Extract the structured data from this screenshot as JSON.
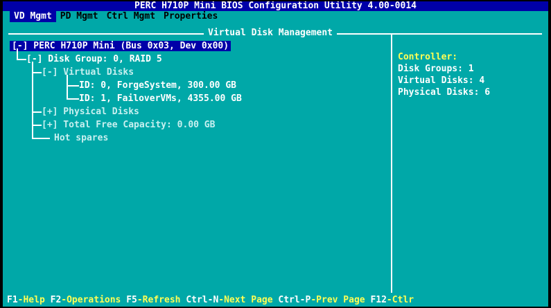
{
  "title": "PERC H710P Mini BIOS Configuration Utility 4.00-0014",
  "menu": [
    {
      "label": "VD Mgmt"
    },
    {
      "label": "PD Mgmt"
    },
    {
      "label": "Ctrl Mgmt"
    },
    {
      "label": "Properties"
    }
  ],
  "panel_title": "Virtual Disk Management",
  "tree": {
    "root": "[-] PERC H710P Mini (Bus 0x03, Dev 0x00)",
    "disk_group": "[-] Disk Group: 0, RAID 5",
    "virtual_disks": "[-] Virtual Disks",
    "vd0": "ID: 0, ForgeSystem, 300.00 GB",
    "vd1": "ID: 1, FailoverVMs, 4355.00 GB",
    "physical_disks": "[+] Physical Disks",
    "free_capacity": "[+] Total Free Capacity: 0.00 GB",
    "hot_spares": "Hot spares"
  },
  "info": {
    "heading": "Controller:",
    "disk_groups": "Disk Groups: 1",
    "virtual_disks": "Virtual Disks: 4",
    "physical_disks": "Physical Disks: 6"
  },
  "footer": [
    {
      "key": "F1",
      "desc": "-Help "
    },
    {
      "key": "F2",
      "desc": "-Operations "
    },
    {
      "key": "F5",
      "desc": "-Refresh "
    },
    {
      "key": "Ctrl-N",
      "desc": "-Next Page "
    },
    {
      "key": "Ctrl-P",
      "desc": "-Prev Page "
    },
    {
      "key": "F12",
      "desc": "-Ctlr"
    }
  ],
  "colors": {
    "background": "#00a8a8",
    "selection": "#0000a8",
    "highlight": "#ffff55",
    "text": "#ffffff"
  }
}
